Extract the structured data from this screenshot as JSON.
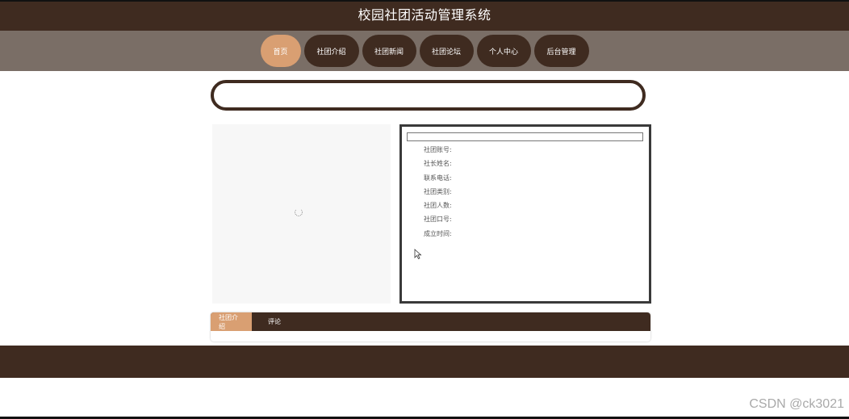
{
  "app": {
    "title": "校园社团活动管理系统"
  },
  "nav": {
    "items": [
      {
        "label": "首页",
        "active": true
      },
      {
        "label": "社团介绍",
        "active": false
      },
      {
        "label": "社团新闻",
        "active": false
      },
      {
        "label": "社团论坛",
        "active": false
      },
      {
        "label": "个人中心",
        "active": false
      },
      {
        "label": "后台管理",
        "active": false
      }
    ]
  },
  "search": {
    "value": ""
  },
  "club_info": {
    "title": "",
    "fields": [
      {
        "label": "社团账号:",
        "value": ""
      },
      {
        "label": "社长姓名:",
        "value": ""
      },
      {
        "label": "联系电话:",
        "value": ""
      },
      {
        "label": "社团类别:",
        "value": ""
      },
      {
        "label": "社团人数:",
        "value": ""
      },
      {
        "label": "社团口号:",
        "value": ""
      },
      {
        "label": "成立时间:",
        "value": ""
      }
    ]
  },
  "tabs": [
    {
      "label": "社团介绍",
      "active": true
    },
    {
      "label": "评论",
      "active": false
    }
  ],
  "watermark": "CSDN @ck3021",
  "colors": {
    "primary": "#3f2b20",
    "accent": "#d99f72",
    "nav_bg": "#7a6e66"
  }
}
